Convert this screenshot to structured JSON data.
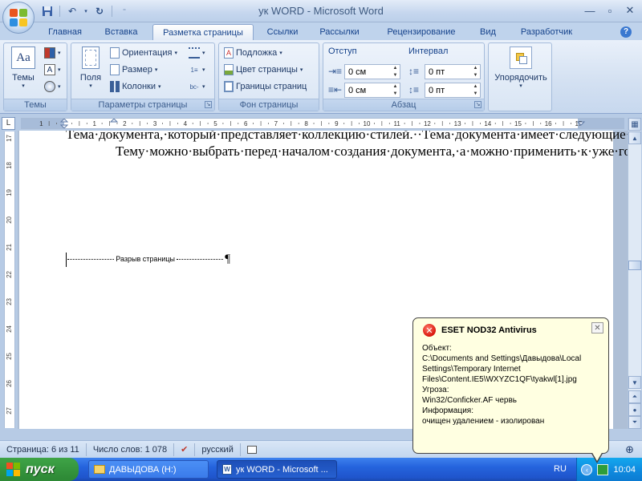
{
  "window": {
    "title": "ук WORD - Microsoft Word"
  },
  "tabs": [
    {
      "label": "Главная"
    },
    {
      "label": "Вставка"
    },
    {
      "label": "Разметка страницы"
    },
    {
      "label": "Ссылки"
    },
    {
      "label": "Рассылки"
    },
    {
      "label": "Рецензирование"
    },
    {
      "label": "Вид"
    },
    {
      "label": "Разработчик"
    }
  ],
  "ribbon": {
    "themes": {
      "button": "Темы",
      "group": "Темы"
    },
    "page_setup": {
      "fields": "Поля",
      "orientation": "Ориентация",
      "size": "Размер",
      "columns": "Колонки",
      "group": "Параметры страницы"
    },
    "background": {
      "watermark": "Подложка",
      "page_color": "Цвет страницы",
      "page_borders": "Границы страниц",
      "group": "Фон страницы"
    },
    "paragraph": {
      "indent_head": "Отступ",
      "spacing_head": "Интервал",
      "indent_left": "0 см",
      "indent_right": "0 см",
      "spacing_before": "0 пт",
      "spacing_after": "0 пт",
      "group": "Абзац"
    },
    "arrange": {
      "button": "Упорядочить"
    }
  },
  "ruler": {
    "h_numbers": [
      "1",
      "1",
      "2",
      "3",
      "4",
      "5",
      "6",
      "7",
      "8",
      "9",
      "10",
      "11",
      "12",
      "13",
      "14",
      "15",
      "16",
      "17"
    ],
    "v_numbers": [
      "17",
      "18",
      "19",
      "20",
      "21",
      "22",
      "23",
      "24",
      "25",
      "26",
      "27"
    ]
  },
  "document": {
    "para1": "Тема·документа,·который·представляет·коллекцию·стилей.··Тема·документа·имеет·следующие·компоненты:·Цвета,·Шрифты,·Эффекты.¶",
    "para2": "Тему·можно·выбрать·перед·началом·создания·документа,·а·можно·применить·к·уже·готовому·тексту.·Для·этого·нужно·перейти·на·вкладку·Разметка·страницы·и·раскрыть·список·Темы.·При·выборе·Темы·сразу·видно·как·меняется·текст.·Можно·менять·компоненты·темы·(Цвета,·Шрифты,·Эффекты).¶",
    "page_break": "Разрыв страницы",
    "pilcrow": "¶"
  },
  "statusbar": {
    "page": "Страница: 6 из 11",
    "words": "Число слов: 1 078",
    "language": "русский"
  },
  "balloon": {
    "title": "ESET NOD32 Antivirus",
    "lines": [
      "Объект:",
      "C:\\Documents and Settings\\Давыдова\\Local",
      "Settings\\Temporary Internet",
      "Files\\Content.IE5\\WXYZC1QF\\tyakwl[1].jpg",
      "Угроза:",
      "Win32/Conficker.AF червь",
      "Информация:",
      "очищен удалением - изолирован"
    ]
  },
  "taskbar": {
    "start": "пуск",
    "items": [
      {
        "label": "ДАВЫДОВА (H:)"
      },
      {
        "label": "ук WORD - Microsoft ..."
      }
    ],
    "lang": "RU",
    "clock": "10:04"
  },
  "colors": {
    "accent": "#15428b",
    "taskbar": "#2563dd",
    "start": "#37983f",
    "error": "#d9150b",
    "balloon_bg": "#ffffe1"
  }
}
